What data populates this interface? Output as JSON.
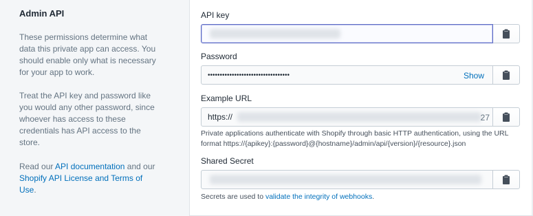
{
  "sidebar": {
    "title": "Admin API",
    "paragraph1": "These permissions determine what data this private app can access. You should enable only what is necessary for your app to work.",
    "paragraph2": "Treat the API key and password like you would any other password, since whoever has access to these credentials has API access to the store.",
    "paragraph3_prefix": "Read our ",
    "api_docs_link": "API documentation",
    "paragraph3_middle": " and our ",
    "license_link": "Shopify API License and Terms of Use",
    "paragraph3_suffix": "."
  },
  "fields": {
    "api_key": {
      "label": "API key"
    },
    "password": {
      "label": "Password",
      "masked_value": "••••••••••••••••••••••••••••••••••",
      "show_label": "Show"
    },
    "example_url": {
      "label": "Example URL",
      "value_prefix": "https://",
      "value_suffix": "27",
      "help": "Private applications authenticate with Shopify through basic HTTP authentication, using the URL format https://{apikey}:{password}@{hostname}/admin/api/{version}/{resource}.json"
    },
    "shared_secret": {
      "label": "Shared Secret",
      "help_prefix": "Secrets are used to ",
      "help_link": "validate the integrity of webhooks",
      "help_suffix": "."
    }
  },
  "icons": {
    "copy": "clipboard-icon"
  },
  "colors": {
    "accent": "#5c6ac4",
    "link": "#006fbb"
  }
}
